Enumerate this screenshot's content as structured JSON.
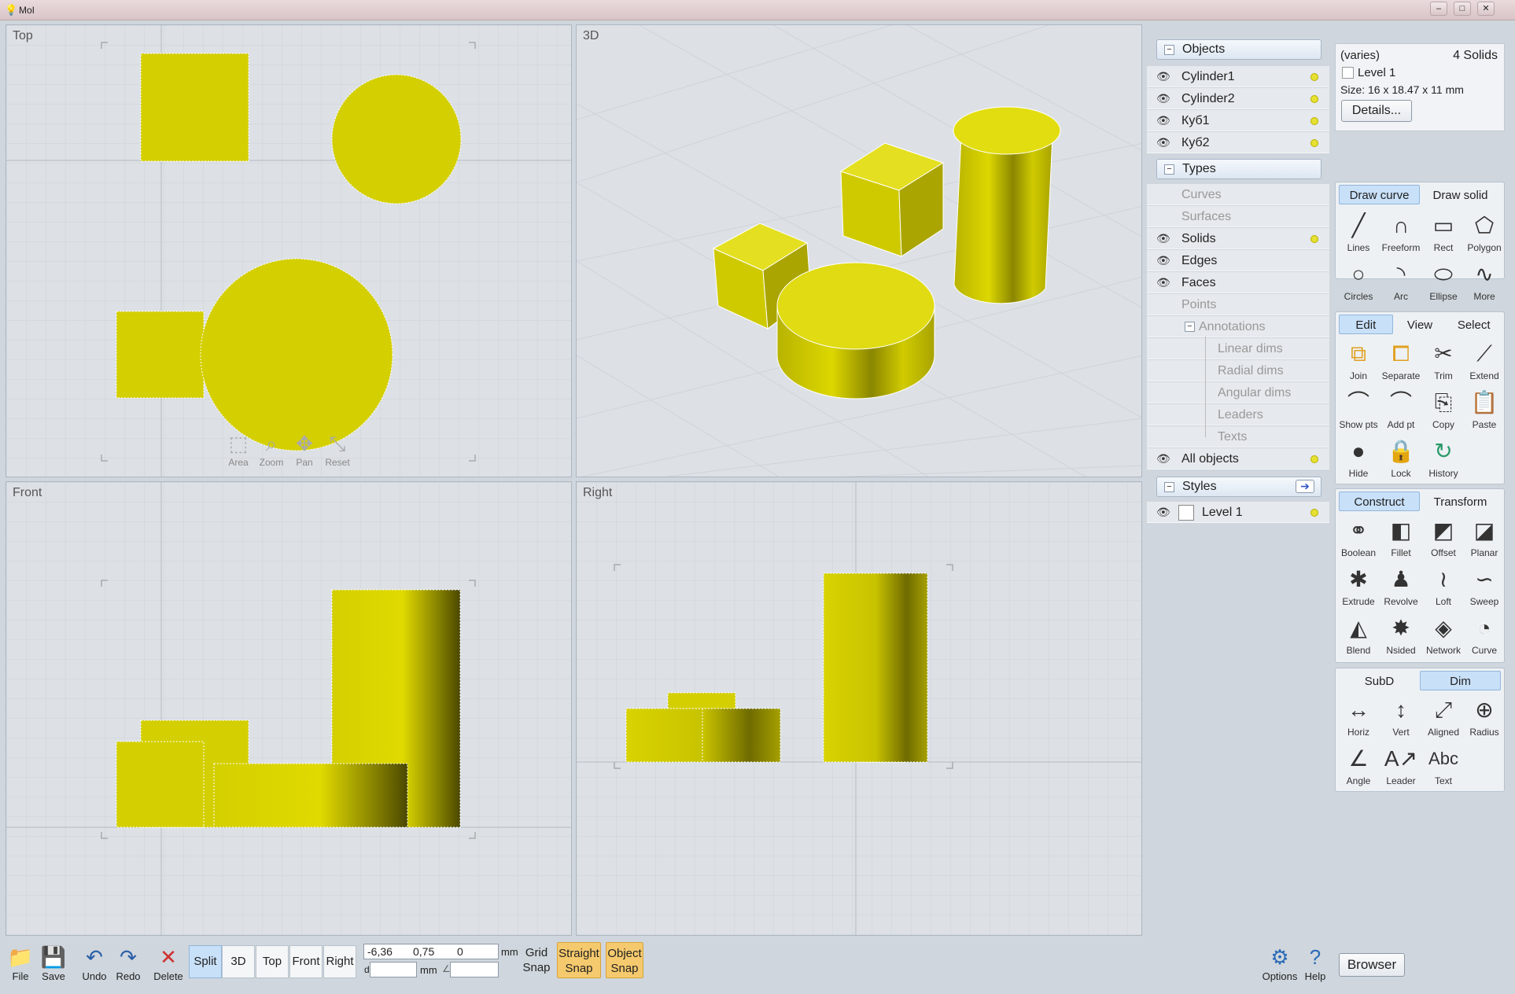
{
  "window": {
    "title": "MoI"
  },
  "viewports": {
    "top": "Top",
    "3d": "3D",
    "front": "Front",
    "right": "Right"
  },
  "nav_tools": [
    {
      "label": "Area",
      "icon": "area-zoom-icon"
    },
    {
      "label": "Zoom",
      "icon": "zoom-icon"
    },
    {
      "label": "Pan",
      "icon": "pan-icon"
    },
    {
      "label": "Reset",
      "icon": "reset-icon"
    }
  ],
  "scene": {
    "objects_header": "Objects",
    "objects": [
      "Cylinder1",
      "Cylinder2",
      "Куб1",
      "Куб2"
    ],
    "types_header": "Types",
    "types": {
      "curves": "Curves",
      "surfaces": "Surfaces",
      "solids": "Solids",
      "edges": "Edges",
      "faces": "Faces",
      "points": "Points",
      "annotations": "Annotations",
      "linear": "Linear dims",
      "radial": "Radial dims",
      "angular": "Angular dims",
      "leaders": "Leaders",
      "texts": "Texts"
    },
    "all_objects": "All objects",
    "styles_header": "Styles",
    "style_level": "Level 1",
    "dot_color": "#e6e033"
  },
  "properties": {
    "name": "(varies)",
    "count": "4 Solids",
    "level": "Level 1",
    "size": "Size: 16 x 18.47 x 11 mm",
    "details": "Details..."
  },
  "draw_panel": {
    "tabs": [
      "Draw curve",
      "Draw solid"
    ],
    "tools": [
      "Lines",
      "Freeform",
      "Rect",
      "Polygon",
      "Circles",
      "Arc",
      "Ellipse",
      "More"
    ]
  },
  "edit_panel": {
    "tabs": [
      "Edit",
      "View",
      "Select"
    ],
    "tools": [
      "Join",
      "Separate",
      "Trim",
      "Extend",
      "Show pts",
      "Add pt",
      "Copy",
      "Paste",
      "Hide",
      "Lock",
      "History"
    ]
  },
  "construct_panel": {
    "tabs": [
      "Construct",
      "Transform"
    ],
    "tools": [
      "Boolean",
      "Fillet",
      "Offset",
      "Planar",
      "Extrude",
      "Revolve",
      "Loft",
      "Sweep",
      "Blend",
      "Nsided",
      "Network",
      "Curve"
    ]
  },
  "dim_panel": {
    "tabs": [
      "SubD",
      "Dim"
    ],
    "tools": [
      "Horiz",
      "Vert",
      "Aligned",
      "Radius",
      "Angle",
      "Leader",
      "Text"
    ],
    "text_glyph": "Abc"
  },
  "bottom": {
    "file": "File",
    "save": "Save",
    "undo": "Undo",
    "redo": "Redo",
    "delete": "Delete",
    "views": [
      "Split",
      "3D",
      "Top",
      "Front",
      "Right"
    ],
    "coord_x": "-6,36",
    "coord_y": "0,75",
    "coord_z": "0",
    "unit": "mm",
    "unit2": "mm",
    "d_label": "d",
    "grid_snap": [
      "Grid",
      "Snap"
    ],
    "straight_snap": [
      "Straight",
      "Snap"
    ],
    "object_snap": [
      "Object",
      "Snap"
    ],
    "options": "Options",
    "help": "Help",
    "browser": "Browser"
  }
}
